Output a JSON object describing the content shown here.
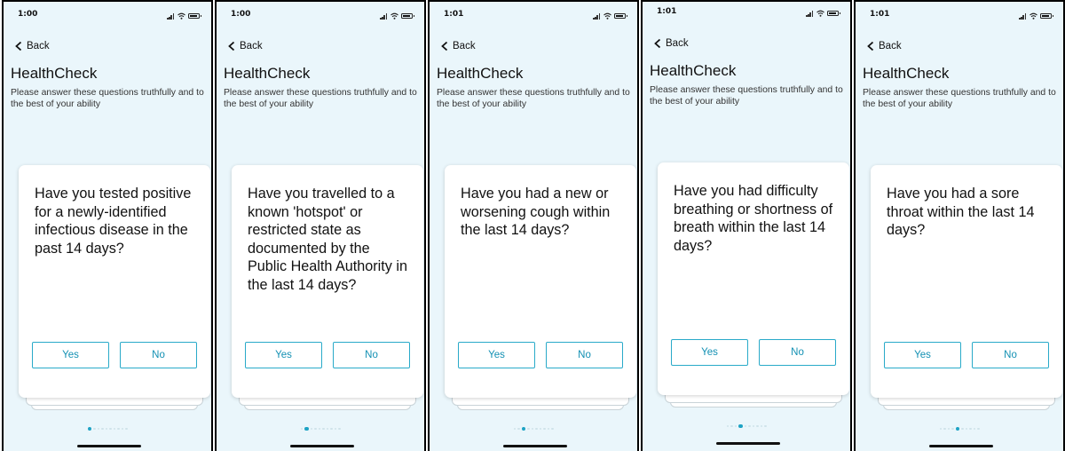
{
  "colors": {
    "screen_bg": "#eaf6fb",
    "card_bg": "#ffffff",
    "accent": "#1ea3c4",
    "button_border": "#29aac9",
    "button_text": "#1290b3",
    "text": "#111111"
  },
  "icons": {
    "back": "chevron-left-icon",
    "signal": "signal-icon",
    "wifi": "wifi-icon",
    "battery": "battery-icon"
  },
  "screens": [
    {
      "status_time": "1:00",
      "back_label": "Back",
      "app_title": "HealthCheck",
      "subtitle": "Please answer these questions truthfully and to the best of your ability",
      "question": "Have you tested positive for a newly-identified infectious disease in the past 14 days?",
      "yes_label": "Yes",
      "no_label": "No",
      "page_count": 10,
      "current_page": 1
    },
    {
      "status_time": "1:00",
      "back_label": "Back",
      "app_title": "HealthCheck",
      "subtitle": "Please answer these questions truthfully and to the best of your ability",
      "question": "Have you travelled to a known 'hotspot' or restricted state as documented by the Public Health Authority in the last 14 days?",
      "yes_label": "Yes",
      "no_label": "No",
      "page_count": 10,
      "current_page": 2
    },
    {
      "status_time": "1:01",
      "back_label": "Back",
      "app_title": "HealthCheck",
      "subtitle": "Please answer these questions truthfully and to the best of your ability",
      "question": "Have you had a new or worsening cough within the last 14 days?",
      "yes_label": "Yes",
      "no_label": "No",
      "page_count": 10,
      "current_page": 3
    },
    {
      "status_time": "1:01",
      "back_label": "Back",
      "app_title": "HealthCheck",
      "subtitle": "Please answer these questions truthfully and to the best of your ability",
      "question": "Have you had difficulty breathing or shortness of breath within the last 14 days?",
      "yes_label": "Yes",
      "no_label": "No",
      "page_count": 10,
      "current_page": 4
    },
    {
      "status_time": "1:01",
      "back_label": "Back",
      "app_title": "HealthCheck",
      "subtitle": "Please answer these questions truthfully and to the best of your ability",
      "question": "Have you had a sore throat within the last 14 days?",
      "yes_label": "Yes",
      "no_label": "No",
      "page_count": 10,
      "current_page": 5
    }
  ]
}
